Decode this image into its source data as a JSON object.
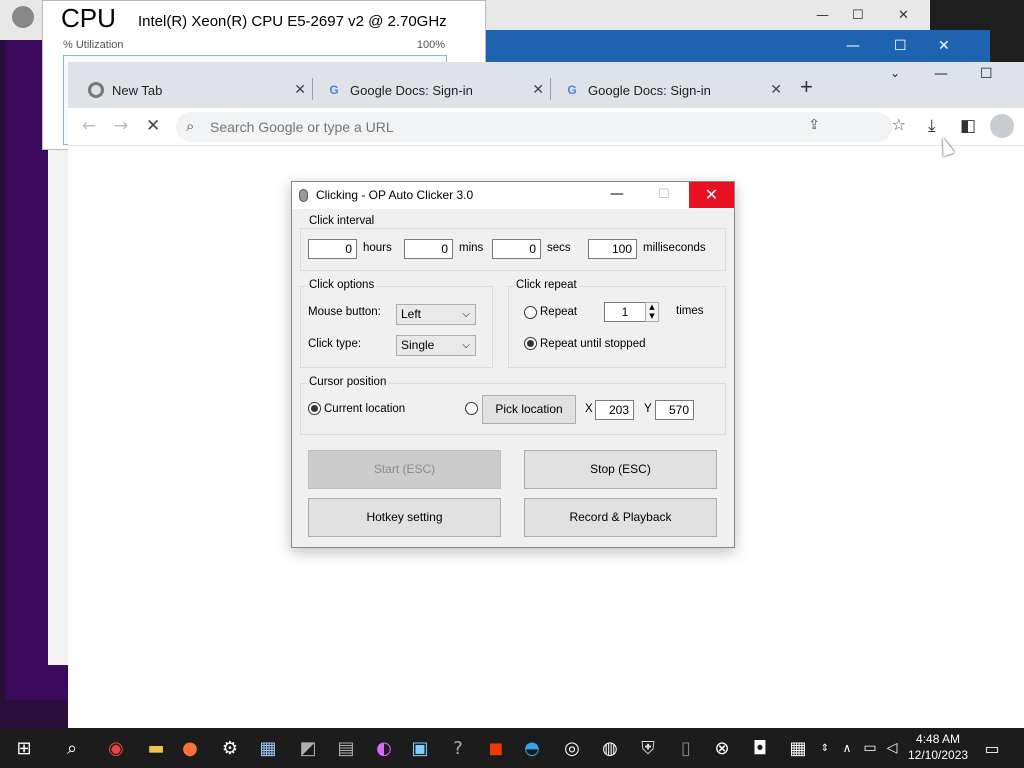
{
  "taskmgr": {
    "cpu_title": "CPU",
    "cpu_model": "Intel(R) Xeon(R) CPU E5-2697 v2 @ 2.70GHz",
    "utilization_label": "% Utilization",
    "max_pct": "100%"
  },
  "chrome": {
    "tabs": [
      {
        "title": "New Tab",
        "icon": "chrome-icon"
      },
      {
        "title": "Google Docs: Sign-in",
        "icon": "google-icon"
      },
      {
        "title": "Google Docs: Sign-in",
        "icon": "google-icon"
      }
    ],
    "omnibox_placeholder": "Search Google or type a URL"
  },
  "clicker": {
    "title": "Clicking - OP Auto Clicker 3.0",
    "interval": {
      "label": "Click interval",
      "hours": "0",
      "hours_label": "hours",
      "mins": "0",
      "mins_label": "mins",
      "secs": "0",
      "secs_label": "secs",
      "ms": "100",
      "ms_label": "milliseconds"
    },
    "options": {
      "label": "Click options",
      "mouse_button_label": "Mouse button:",
      "mouse_button_value": "Left",
      "click_type_label": "Click type:",
      "click_type_value": "Single"
    },
    "repeat": {
      "label": "Click repeat",
      "repeat_label": "Repeat",
      "repeat_count": "1",
      "times_label": "times",
      "until_stopped_label": "Repeat until stopped",
      "selected": "until_stopped"
    },
    "cursor": {
      "label": "Cursor position",
      "current_label": "Current location",
      "pick_label": "Pick location",
      "x_label": "X",
      "x_value": "203",
      "y_label": "Y",
      "y_value": "570",
      "selected": "current"
    },
    "buttons": {
      "start": "Start (ESC)",
      "stop": "Stop (ESC)",
      "hotkey": "Hotkey setting",
      "record": "Record & Playback"
    }
  },
  "taskbar": {
    "time": "4:48 AM",
    "date": "12/10/2023"
  },
  "colors": {
    "close_red": "#e81123",
    "taskbar": "#1c1c1c",
    "dialog_bg": "#f0f0f0"
  }
}
